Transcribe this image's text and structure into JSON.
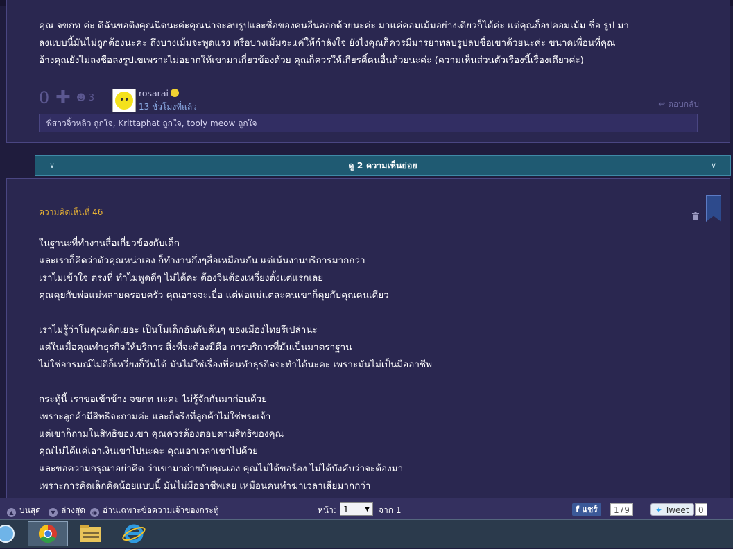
{
  "post": {
    "lines": [
      "คุณ จขกท ค่ะ ดิฉันขอติงคุณนิดนะค่ะคุณน่าจะลบรูปและชื่อของคนอื่นออกด้วยนะค่ะ มาแค่คอมเม้มอย่างเดียวก็ได้ค่ะ แต่คุณก็อปคอมเม้ม ชื่อ รูป มา",
      "ลงแบบนี้มันไม่ถูกต้องนะค่ะ  ถึงบางเม้มจะพูดแรง หรือบางเม้มจะแค่ให้กำลังใจ ยังไงคุณก็ควรมีมารยาทลบรูปลบชื่อเขาด้วยนะค่ะ ขนาดเพื่อนที่คุณ",
      "อ้างคุณยังไม่ลงชื่อลงรูปเขเพราะไม่อยากให้เขามาเกี่ยวข้องด้วย คุณก็ควรให้เกียรติ์คนอื่นด้วยนะค่ะ (ความเห็นส่วนตัวเรื่องนี้เรื่องเดียวค่ะ)"
    ],
    "vote_score": "0",
    "reply_count": "3",
    "username": "rosarai",
    "time_ago": "13 ชั่วโมงที่แล้ว",
    "reply_label": "ตอบกลับ",
    "likes_text": "พี่สาวจิ้วหลิว ถูกใจ, Krittaphat ถูกใจ, tooly meow ถูกใจ"
  },
  "expander_label": "ดู 2 ความเห็นย่อย",
  "comment": {
    "label": "ความคิดเห็นที่ 46",
    "paragraphs": [
      [
        "ในฐานะที่ทำงานสื่อเกี่ยวข้องกับเด็ก",
        "และเราก็คิดว่าตัวคุณหน่าเอง ก็ทำงานกึ่งๆสื่อเหมือนกัน แต่เน้นงานบริการมากกว่า",
        "เราไม่เข้าใจ ตรงที่ ทำไมพูดดีๆ ไม่ได้คะ ต้องวีนต้องเหวี่ยงตั้งแต่แรกเลย",
        "คุณคุยกับพ่อแม่หลายครอบครัว คุณอาจจะเบื่อ แต่พ่อแม่แต่ละคนเขาก็คุยกับคุณคนเดียว"
      ],
      [
        "เราไม่รู้ว่าโมคุณเด็กเยอะ เป็นโมเด็กอันดับต้นๆ ของเมืองไทยรึเปล่านะ",
        "แต่ในเมื่อคุณทำธุรกิจให้บริการ สิ่งที่จะต้องมีคือ การบริการที่มันเป็นมาตราฐาน",
        "ไม่ใช่อารมณ์ไม่ดีก็เหวี่ยงก็วีนได้ มันไม่ใช่เรื่องที่คนทำธุรกิจจะทำได้นะคะ เพราะมันไม่เป็นมืออาชีพ"
      ],
      [
        "กระทู้นี้ เราขอเข้าข้าง จขกท นะคะ ไม่รู้จักกันมาก่อนด้วย",
        "เพราะลูกค้ามีสิทธิจะถามค่ะ และก็จริงที่ลูกค้าไม่ใช่พระเจ้า",
        "แต่เขาก็ถามในสิทธิของเขา คุณควรต้องตอบตามสิทธิของคุณ",
        "คุณไม่ได้แค่เอาเงินเขาไปนะคะ คุณเอาเวลาเขาไปด้วย",
        "และขอความกรุณาอย่าคิด ว่าเขามาถ่ายกับคุณเอง คุณไม่ได้ขอร้อง ไม่ได้บังคับว่าจะต้องมา",
        "เพราะการคิดเล็กคิดน้อยแบบนี้ มันไม่มืออาชีพเลย เหมือนคนทำฆ่าเวลาเสียมากกว่า"
      ]
    ]
  },
  "bottom_bar": {
    "top_label": "บนสุด",
    "bottom_label": "ล่างสุด",
    "owner_only_label": "อ่านเฉพาะข้อความเจ้าของกระทู้",
    "page_label": "หน้า:",
    "page_value": "1",
    "of_label": "จาก 1",
    "share_label": "แชร์",
    "share_count": "179",
    "tweet_label": "Tweet",
    "tweet_count": "0"
  },
  "colors": {
    "background": "#1f1c3d",
    "card": "#2a2750",
    "comment_label": "#e8b234",
    "expander": "#1f5a72",
    "facebook": "#3b5998"
  }
}
